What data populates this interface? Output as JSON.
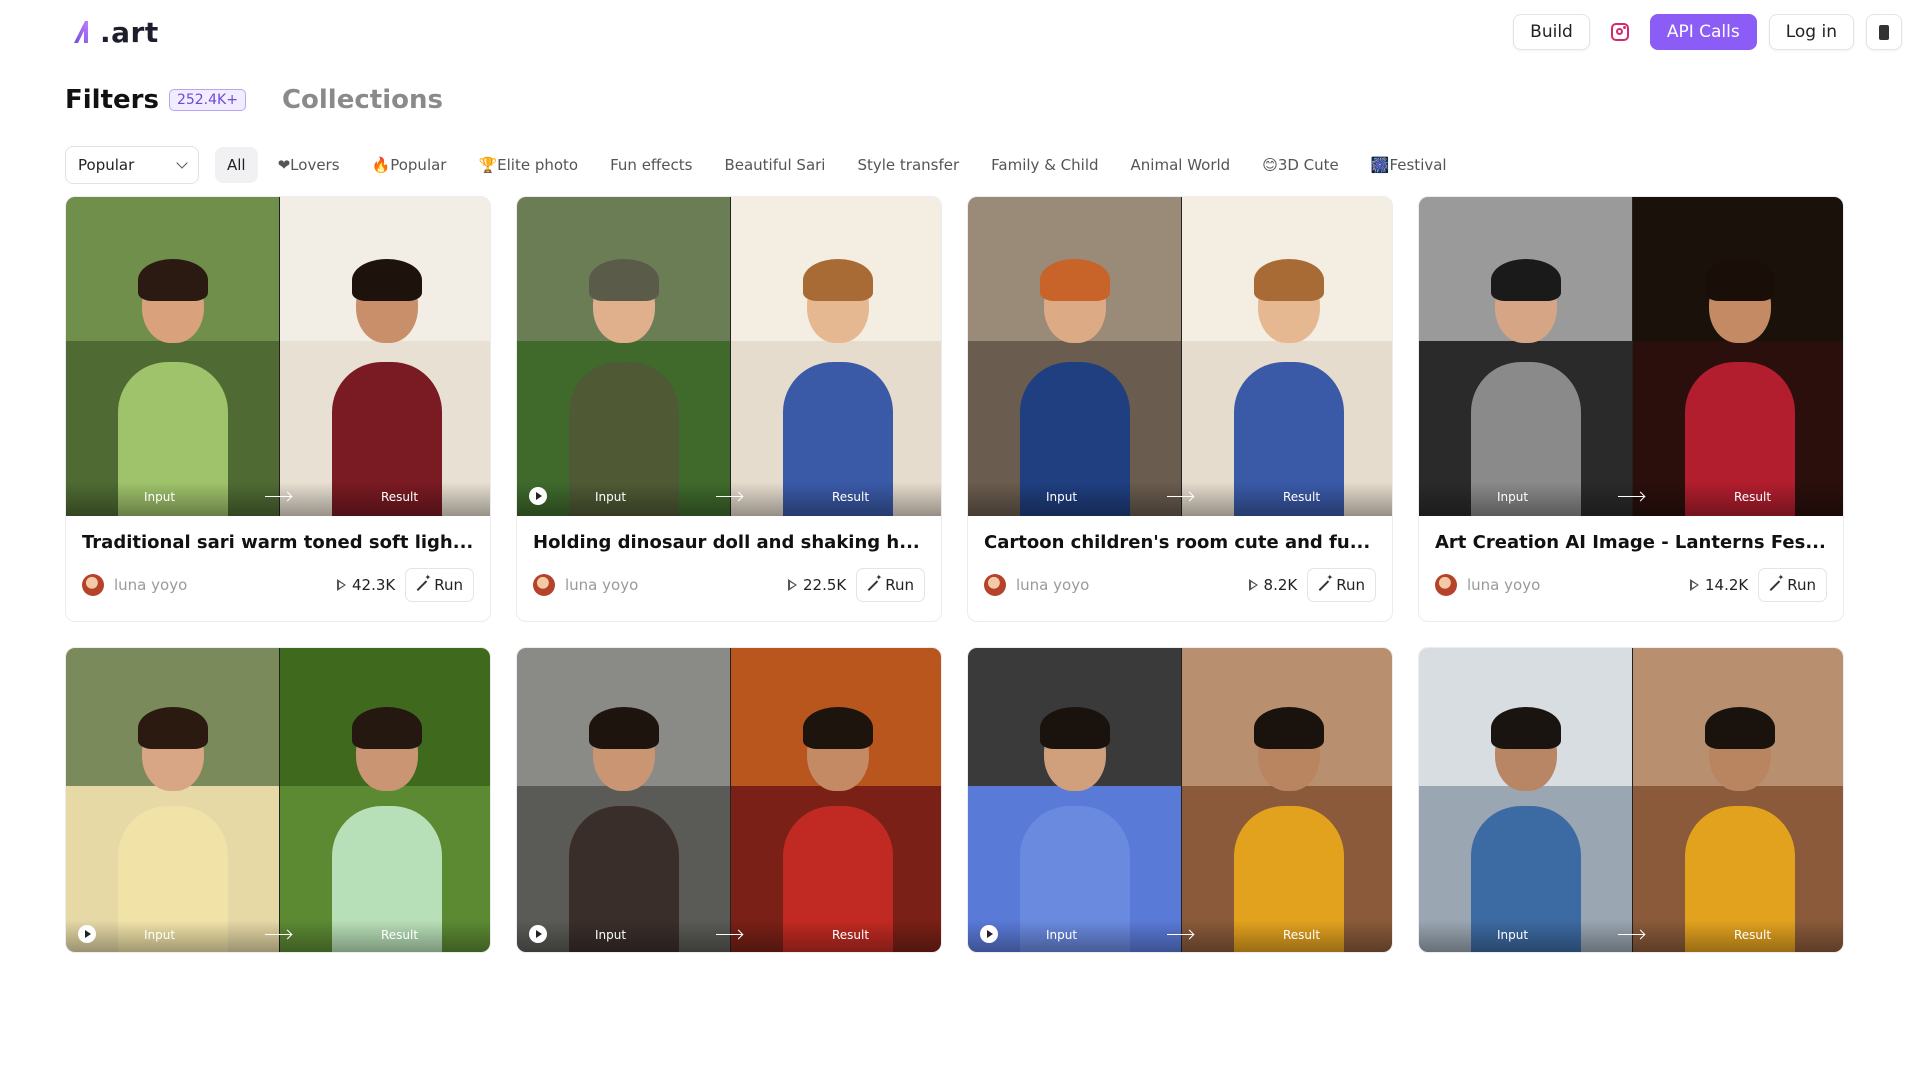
{
  "header": {
    "logo_text": ".art",
    "build_label": "Build",
    "api_label": "API Calls",
    "login_label": "Log in",
    "brand_color": "#8b5cf6"
  },
  "section": {
    "filters_tab": "Filters",
    "count_badge": "252.4K+",
    "collections_tab": "Collections"
  },
  "sort": {
    "selected": "Popular"
  },
  "chips": [
    "All",
    "❤Lovers",
    "🔥Popular",
    "🏆Elite photo",
    "Fun effects",
    "Beautiful Sari",
    "Style transfer",
    "Family & Child",
    "Animal World",
    "😊3D Cute",
    "🎆Festival"
  ],
  "labels": {
    "input": "Input",
    "result": "Result",
    "run": "Run"
  },
  "cards": [
    {
      "title": "Traditional sari warm toned soft ligh...",
      "author": "luna yoyo",
      "runs": "42.3K",
      "video": false,
      "icon": "sari-portrait",
      "left": {
        "sky": "#6f8f4a",
        "ground": "#4f6b33",
        "hair": "#2a1a12",
        "skin": "#d9a27c",
        "body": "#9fc36b"
      },
      "right": {
        "sky": "#f2eee6",
        "ground": "#e8e0d2",
        "hair": "#1d120c",
        "skin": "#c98f6a",
        "body": "#7a1a22"
      }
    },
    {
      "title": "Holding dinosaur doll and shaking h...",
      "author": "luna yoyo",
      "runs": "22.5K",
      "video": true,
      "icon": "child-portrait",
      "left": {
        "sky": "#6b7d55",
        "ground": "#3f6a2c",
        "hair": "#5b5b4a",
        "skin": "#e0b08c",
        "body": "#4f5a35"
      },
      "right": {
        "sky": "#f3ede2",
        "ground": "#e6dccd",
        "hair": "#a86b35",
        "skin": "#e6b892",
        "body": "#3a5aa8"
      }
    },
    {
      "title": "Cartoon children's room cute and fu...",
      "author": "luna yoyo",
      "runs": "8.2K",
      "video": false,
      "icon": "child-portrait",
      "left": {
        "sky": "#9a8a78",
        "ground": "#6a5c4e",
        "hair": "#c8632a",
        "skin": "#dcaa84",
        "body": "#1f3f80"
      },
      "right": {
        "sky": "#f3ede2",
        "ground": "#e6dccd",
        "hair": "#a86b35",
        "skin": "#e6b892",
        "body": "#3a5aa8"
      }
    },
    {
      "title": "Art Creation AI Image - Lanterns Fes...",
      "author": "luna yoyo",
      "runs": "14.2K",
      "video": false,
      "icon": "couple-portrait",
      "left": {
        "sky": "#9a9a9a",
        "ground": "#2a2a2a",
        "hair": "#1a1a1a",
        "skin": "#d6a586",
        "body": "#8a8a8a"
      },
      "right": {
        "sky": "#1a120a",
        "ground": "#2a0f0c",
        "hair": "#1a0e08",
        "skin": "#c48a64",
        "body": "#b21e2e"
      }
    },
    {
      "title": "",
      "author": "",
      "runs": "",
      "video": true,
      "icon": "man-portrait",
      "left": {
        "sky": "#7a8a5a",
        "ground": "#e6d9a6",
        "hair": "#2a1a10",
        "skin": "#d8a684",
        "body": "#f1e3a8"
      },
      "right": {
        "sky": "#3f6a1e",
        "ground": "#5c8a33",
        "hair": "#241810",
        "skin": "#c99572",
        "body": "#b8e0b8"
      }
    },
    {
      "title": "",
      "author": "",
      "runs": "",
      "video": true,
      "icon": "man-portrait",
      "left": {
        "sky": "#8a8a86",
        "ground": "#5a5a56",
        "hair": "#1e140e",
        "skin": "#c99573",
        "body": "#3a2e2a"
      },
      "right": {
        "sky": "#b8561e",
        "ground": "#7a2016",
        "hair": "#1e140e",
        "skin": "#c48a64",
        "body": "#c02a22"
      }
    },
    {
      "title": "",
      "author": "",
      "runs": "",
      "video": true,
      "icon": "man-portrait",
      "left": {
        "sky": "#3a3a3a",
        "ground": "#5a7ad8",
        "hair": "#1a120c",
        "skin": "#d0a07c",
        "body": "#6a8ae0"
      },
      "right": {
        "sky": "#b89070",
        "ground": "#8a5a3a",
        "hair": "#1a120c",
        "skin": "#b98460",
        "body": "#e3a21e"
      }
    },
    {
      "title": "",
      "author": "",
      "runs": "",
      "video": false,
      "icon": "man-portrait",
      "left": {
        "sky": "#d8dde2",
        "ground": "#9aa6b2",
        "hair": "#1a1410",
        "skin": "#b88664",
        "body": "#3c6aa2"
      },
      "right": {
        "sky": "#b89070",
        "ground": "#8a5a3a",
        "hair": "#1a120c",
        "skin": "#b98460",
        "body": "#e3a21e"
      }
    }
  ]
}
